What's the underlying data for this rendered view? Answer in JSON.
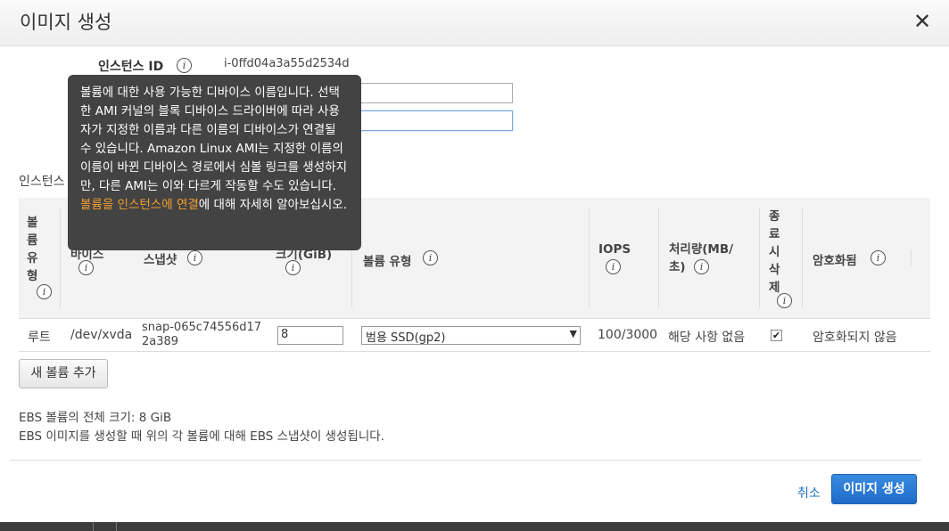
{
  "dialog": {
    "title": "이미지 생성",
    "close_glyph": "✕"
  },
  "form": {
    "instance_id_label": "인스턴스 ID",
    "instance_id_value": "i-0ffd04a3a55d2534d",
    "section_partial_label": "인스턴스"
  },
  "info_glyph": "i",
  "table": {
    "headers": {
      "volume_type_col": "볼륨유형",
      "device_partial": "바이스",
      "snapshot": "스냅샷",
      "size_partial": "크기(GiB)",
      "volume_kind": "볼륨 유형",
      "iops": "IOPS",
      "throughput": "처리량(MB/초)",
      "delete_on_term": "종료시삭제",
      "encrypted": "암호화됨"
    },
    "row": {
      "volume_type": "루트",
      "device": "/dev/xvda",
      "snapshot": "snap-065c74556d172a389",
      "size": "8",
      "volume_kind": "범용 SSD(gp2)",
      "iops": "100/3000",
      "throughput": "해당 사항 없음",
      "delete_on_term_checked": true,
      "encrypted": "암호화되지 않음"
    }
  },
  "add_volume_button": "새 볼륨 추가",
  "summary": {
    "total_size": "EBS 볼륨의 전체 크기: 8 GiB",
    "snapshot_note": "EBS 이미지를 생성할 때 위의 각 볼륨에 대해 EBS 스냅샷이 생성됩니다."
  },
  "footer": {
    "cancel": "취소",
    "create": "이미지 생성"
  },
  "tooltip": {
    "text": "볼륨에 대한 사용 가능한 디바이스 이름입니다. 선택한 AMI 커널의 블록 디바이스 드라이버에 따라 사용자가 지정한 이름과 다른 이름의 디바이스가 연결될 수 있습니다. Amazon Linux AMI는 지정한 이름의 이름이 바뀐 디바이스 경로에서 심볼 링크를 생성하지만, 다른 AMI는 이와 다르게 작동할 수도 있습니다. ",
    "link": "볼륨을 인스턴스에 연결",
    "text_after": "에 대해 자세히 알아보십시오."
  },
  "colors": {
    "primary_button": "#1e6cc8",
    "link": "#1e73c8",
    "tooltip_bg": "#434343",
    "tooltip_link": "#f29d2f"
  }
}
